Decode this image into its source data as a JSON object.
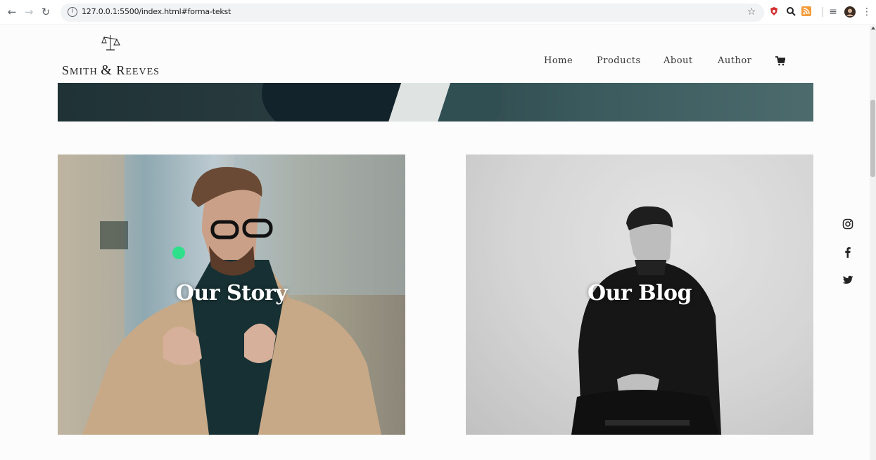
{
  "browser": {
    "url": "127.0.0.1:5500/index.html#forma-tekst",
    "back_icon": "back-arrow-icon",
    "forward_icon": "forward-arrow-icon",
    "reload_icon": "reload-icon",
    "star_icon": "star-icon"
  },
  "site": {
    "brand": "Smith & Reeves",
    "brand_first": "S",
    "brand_mid": "MITH ",
    "brand_amp": "&",
    "brand_r": " R",
    "brand_rest": "EEVES",
    "logo_icon": "scales-icon"
  },
  "nav": {
    "items": [
      {
        "label": "Home"
      },
      {
        "label": "Products"
      },
      {
        "label": "About"
      },
      {
        "label": "Author"
      }
    ],
    "cart_icon": "cart-icon"
  },
  "cards": [
    {
      "title": "Our Story"
    },
    {
      "title": "Our Blog"
    }
  ],
  "social": [
    "instagram-icon",
    "facebook-icon",
    "twitter-icon"
  ],
  "colors": {
    "text": "#333333",
    "hero": "#2c4448",
    "background": "#fcfcfc"
  }
}
